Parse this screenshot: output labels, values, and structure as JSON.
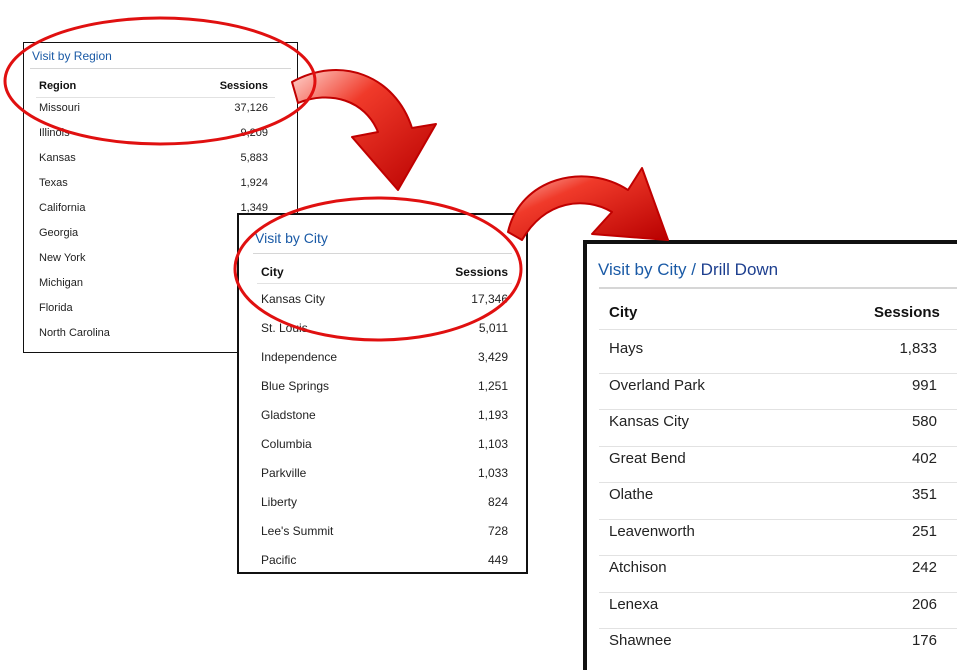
{
  "region_panel": {
    "title": "Visit by Region",
    "col_region": "Region",
    "col_sessions": "Sessions",
    "rows": [
      {
        "name": "Missouri",
        "sessions": "37,126"
      },
      {
        "name": "Illinois",
        "sessions": "9,209"
      },
      {
        "name": "Kansas",
        "sessions": "5,883"
      },
      {
        "name": "Texas",
        "sessions": "1,924"
      },
      {
        "name": "California",
        "sessions": "1,349"
      },
      {
        "name": "Georgia",
        "sessions": ""
      },
      {
        "name": "New York",
        "sessions": ""
      },
      {
        "name": "Michigan",
        "sessions": ""
      },
      {
        "name": "Florida",
        "sessions": ""
      },
      {
        "name": "North Carolina",
        "sessions": ""
      }
    ]
  },
  "city_panel": {
    "title": "Visit by City",
    "col_city": "City",
    "col_sessions": "Sessions",
    "rows": [
      {
        "name": "Kansas City",
        "sessions": "17,346"
      },
      {
        "name": "St. Louis",
        "sessions": "5,011"
      },
      {
        "name": "Independence",
        "sessions": "3,429"
      },
      {
        "name": "Blue Springs",
        "sessions": "1,251"
      },
      {
        "name": "Gladstone",
        "sessions": "1,193"
      },
      {
        "name": "Columbia",
        "sessions": "1,103"
      },
      {
        "name": "Parkville",
        "sessions": "1,033"
      },
      {
        "name": "Liberty",
        "sessions": "824"
      },
      {
        "name": "Lee's Summit",
        "sessions": "728"
      },
      {
        "name": "Pacific",
        "sessions": "449"
      }
    ]
  },
  "drill_panel": {
    "title_main": "Visit by City",
    "title_sep": " / ",
    "title_drill": "Drill Down",
    "col_city": "City",
    "col_sessions": "Sessions",
    "rows": [
      {
        "name": "Hays",
        "sessions": "1,833"
      },
      {
        "name": "Overland Park",
        "sessions": "991"
      },
      {
        "name": "Kansas City",
        "sessions": "580"
      },
      {
        "name": "Great Bend",
        "sessions": "402"
      },
      {
        "name": "Olathe",
        "sessions": "351"
      },
      {
        "name": "Leavenworth",
        "sessions": "251"
      },
      {
        "name": "Atchison",
        "sessions": "242"
      },
      {
        "name": "Lenexa",
        "sessions": "206"
      },
      {
        "name": "Shawnee",
        "sessions": "176"
      }
    ]
  },
  "colors": {
    "title_blue": "#1a5aa6",
    "highlight_red": "#e01010",
    "arrow_red": "#d40000"
  }
}
